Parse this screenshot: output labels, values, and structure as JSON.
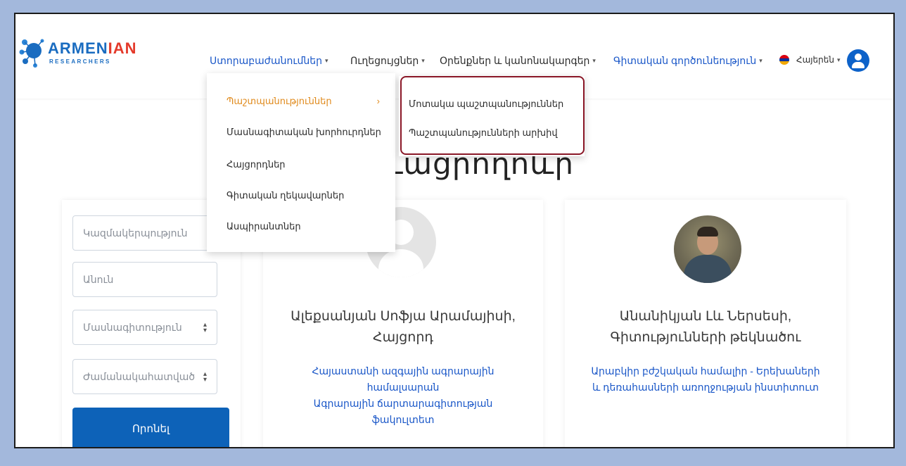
{
  "header": {
    "logo": {
      "name_part1": "ARMEN",
      "name_part2": "IAN",
      "subtitle": "RESEARCHERS"
    },
    "nav": [
      {
        "label": "Ստորաբաժանումներ",
        "caret": "▾"
      },
      {
        "label": "Ուղեցույցներ",
        "caret": "▾"
      },
      {
        "label": "Օրենքներ և կանոնակարգեր",
        "caret": "▾"
      },
      {
        "label": "Գիտական գործունեություն",
        "caret": "▾"
      }
    ],
    "language": {
      "label": "Հայերեն",
      "caret": "▾"
    },
    "colors": {
      "accent": "#1a57c8",
      "brand": "#0d62c9"
    }
  },
  "dropdown": {
    "items": [
      {
        "label": "Պաշտպանություններ",
        "chevron": "›"
      },
      {
        "label": "Մասնագիտական խորհուրդներ"
      },
      {
        "label": "Հայցորդներ"
      },
      {
        "label": "Գիտական ղեկավարներ"
      },
      {
        "label": "Ասպիրանտներ"
      }
    ],
    "submenu": [
      {
        "label": "Մոտակա պաշտպանություններ"
      },
      {
        "label": "Պաշտպանությունների արխիվ"
      }
    ]
  },
  "page": {
    "title": "ւացրողոևր"
  },
  "filters": {
    "organization_placeholder": "Կազմակերպություն",
    "name_placeholder": "Անուն",
    "specialty_select": "Մասնագիտություն",
    "period_select": "Ժամանակահատված",
    "search_button": "Որոնել"
  },
  "cards": [
    {
      "name": "Ալեքսանյան Սոֆյա Արամայիսի,",
      "role": "Հայցորդ",
      "affiliation_lines": [
        "Հայաստանի ազգային ագրարային",
        "համալսարան",
        "Ագրարային ճարտարագիտության",
        "ֆակուլտետ"
      ]
    },
    {
      "name": "Անանիկյան Լև Ներսեսի,",
      "role": "Գիտությունների թեկնածու",
      "affiliation_lines": [
        "Արաբկիր բժշկական համալիր - Երեխաների",
        "և դեռահասների առողջության ինստիտուտ"
      ]
    }
  ]
}
